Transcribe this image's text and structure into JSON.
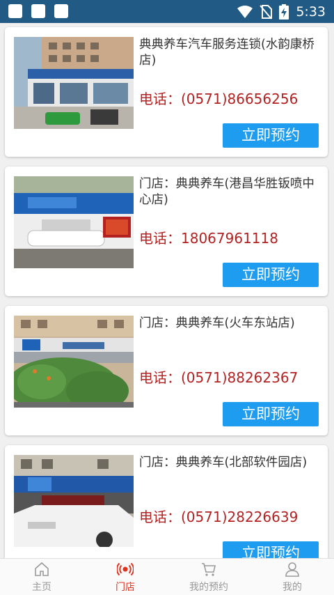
{
  "status_bar": {
    "time": "5:33",
    "icons": [
      "notification-square",
      "notification-square",
      "notification-square",
      "wifi-icon",
      "no-sim-icon",
      "battery-charging-icon"
    ]
  },
  "stores": [
    {
      "name": "典典养车汽车服务连锁(水韵康桥店)",
      "phone": "电话：(0571)86656256",
      "button": "立即预约",
      "image": "store-photo"
    },
    {
      "name": "门店：典典养车(港昌华胜钣喷中心店)",
      "phone": "电话：18067961118",
      "button": "立即预约",
      "image": "store-photo"
    },
    {
      "name": "门店：典典养车(火车东站店)",
      "phone": "电话：(0571)88262367",
      "button": "立即预约",
      "image": "store-photo"
    },
    {
      "name": "门店：典典养车(北部软件园店)",
      "phone": "电话：(0571)28226639",
      "button": "立即预约",
      "image": "store-photo"
    }
  ],
  "tabbar": {
    "active": "stores",
    "items": [
      {
        "key": "home",
        "label": "主页",
        "icon": "home-icon"
      },
      {
        "key": "stores",
        "label": "门店",
        "icon": "broadcast-icon"
      },
      {
        "key": "bookings",
        "label": "我的预约",
        "icon": "cart-icon"
      },
      {
        "key": "me",
        "label": "我的",
        "icon": "user-icon"
      }
    ]
  },
  "colors": {
    "status_bar": "#215a84",
    "phone_text": "#b22222",
    "button_bg": "#1e9cf0",
    "tab_active": "#e0301e",
    "tab_inactive": "#999999"
  }
}
